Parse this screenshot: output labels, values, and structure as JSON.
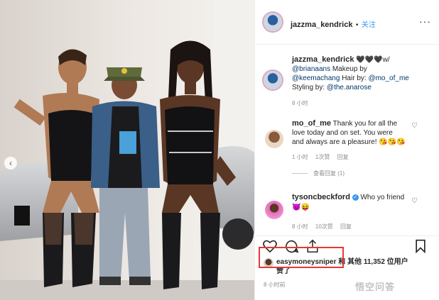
{
  "post": {
    "username": "jazzma_kendrick",
    "separator": "•",
    "follow_label": "关注",
    "more_label": "···"
  },
  "caption": {
    "username": "jazzma_kendrick",
    "emoji": "🖤🖤🖤w/",
    "line1_mention": "@brianaans",
    "line1_text": " Makeup by",
    "line2_mention": "@keemachang",
    "line2_text": " Hair by: ",
    "line2_mention2": "@mo_of_me",
    "line3_text": "Styling by: ",
    "line3_mention": "@the.anarose",
    "time": "8 小时"
  },
  "comments": [
    {
      "username": "mo_of_me",
      "text_line1": " Thank you for all the",
      "text_line2": "love today and on set. You were",
      "text_line3": "and always are a pleasure! 😘😘😘",
      "time": "1 小时",
      "likes": "1次赞",
      "reply": "回复",
      "view_replies": "查看回复 (1)"
    },
    {
      "username": "tysoncbeckford",
      "text": " Who yo friend",
      "reactions": "😈😝",
      "time": "8 小时",
      "likes": "10次赞",
      "reply": "回复"
    }
  ],
  "likes": {
    "user": "easymoneysniper",
    "and": "和",
    "others_label": "其他",
    "count": "11,352",
    "suffix": "位用户",
    "line2": "赞了"
  },
  "post_time": "8 小时前",
  "watermark": "悟空问答",
  "icons": {
    "heart": "heart-icon",
    "comment": "comment-icon",
    "share": "share-icon",
    "bookmark": "bookmark-icon",
    "more": "more-icon",
    "carousel_prev": "chevron-left-icon"
  },
  "colors": {
    "follow": "#3897f0",
    "link": "#00376b",
    "verified": "#3897f0",
    "highlight_box": "#e53935"
  }
}
